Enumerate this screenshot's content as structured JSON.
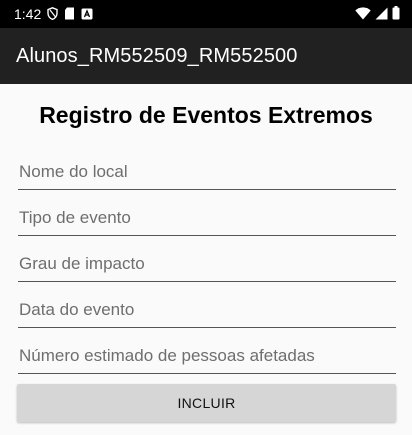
{
  "status_bar": {
    "time": "1:42",
    "icons": [
      "shield-icon",
      "sd-card-icon",
      "app-a-icon",
      "wifi-icon",
      "signal-icon",
      "battery-icon"
    ]
  },
  "app_bar": {
    "title": "Alunos_RM552509_RM552500"
  },
  "form": {
    "title": "Registro de Eventos Extremos",
    "fields": [
      {
        "placeholder": "Nome do local"
      },
      {
        "placeholder": "Tipo de evento"
      },
      {
        "placeholder": "Grau de impacto"
      },
      {
        "placeholder": "Data do evento"
      },
      {
        "placeholder": "Número estimado de pessoas afetadas"
      }
    ],
    "submit_label": "INCLUIR"
  },
  "colors": {
    "status_bar_bg": "#000000",
    "app_bar_bg": "#212121",
    "background": "#fafafa",
    "button_bg": "#d6d6d6",
    "hint_text": "#6e6e6e"
  }
}
